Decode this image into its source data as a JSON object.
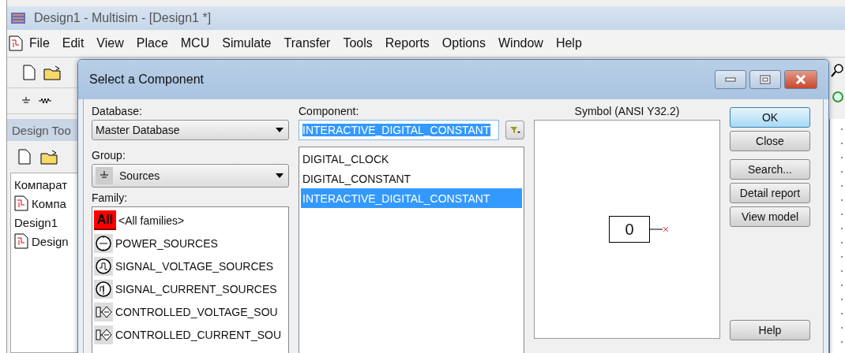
{
  "window": {
    "title": "Design1 - Multisim - [Design1 *]"
  },
  "menu": [
    "File",
    "Edit",
    "View",
    "Place",
    "MCU",
    "Simulate",
    "Transfer",
    "Tools",
    "Reports",
    "Options",
    "Window",
    "Help"
  ],
  "toolbox": {
    "title": "Design Too",
    "tree": [
      {
        "label": "Компарат",
        "kind": "folder"
      },
      {
        "label": "Компа",
        "kind": "file"
      },
      {
        "label": "Design1",
        "kind": "folder"
      },
      {
        "label": "Design",
        "kind": "file"
      }
    ]
  },
  "dialog": {
    "title": "Select a Component",
    "database": {
      "label": "Database:",
      "value": "Master Database"
    },
    "group": {
      "label": "Group:",
      "value": "Sources"
    },
    "family": {
      "label": "Family:",
      "items": [
        {
          "label": "<All families>",
          "kind": "all",
          "badge": "All",
          "selected": false
        },
        {
          "label": "POWER_SOURCES",
          "kind": "power",
          "selected": false
        },
        {
          "label": "SIGNAL_VOLTAGE_SOURCES",
          "kind": "signal_voltage",
          "selected": false
        },
        {
          "label": "SIGNAL_CURRENT_SOURCES",
          "kind": "signal_current",
          "selected": false
        },
        {
          "label": "CONTROLLED_VOLTAGE_SOU",
          "kind": "controlled_voltage",
          "selected": false
        },
        {
          "label": "CONTROLLED_CURRENT_SOU",
          "kind": "controlled_current",
          "selected": false
        }
      ]
    },
    "component": {
      "label": "Component:",
      "value": "INTERACTIVE_DIGITAL_CONSTANT",
      "text_selected": true,
      "items": [
        {
          "label": "DIGITAL_CLOCK",
          "selected": false
        },
        {
          "label": "DIGITAL_CONSTANT",
          "selected": false
        },
        {
          "label": "INTERACTIVE_DIGITAL_CONSTANT",
          "selected": true
        }
      ]
    },
    "symbol": {
      "label": "Symbol (ANSI Y32.2)",
      "value": "0"
    },
    "button_groups": [
      [
        {
          "label": "OK",
          "default": true
        },
        {
          "label": "Close",
          "default": false
        }
      ],
      [
        {
          "label": "Search...",
          "default": false
        },
        {
          "label": "Detail report",
          "default": false
        },
        {
          "label": "View model",
          "default": false
        }
      ],
      [
        {
          "label": "Help",
          "default": false
        }
      ]
    ]
  }
}
